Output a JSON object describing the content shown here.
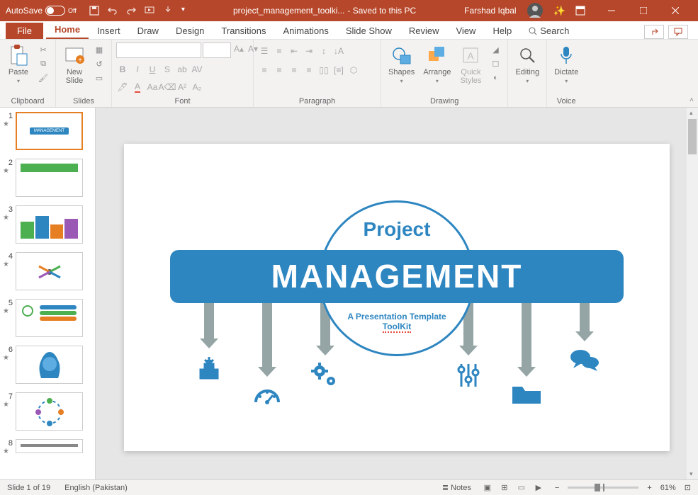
{
  "titlebar": {
    "autosave_label": "AutoSave",
    "autosave_state": "Off",
    "filename": "project_management_toolki...",
    "save_status": " - Saved to this PC",
    "user": "Farshad Iqbal"
  },
  "tabs": {
    "file": "File",
    "items": [
      "Home",
      "Insert",
      "Draw",
      "Design",
      "Transitions",
      "Animations",
      "Slide Show",
      "Review",
      "View",
      "Help"
    ],
    "search": "Search"
  },
  "ribbon": {
    "clipboard": {
      "label": "Clipboard",
      "paste": "Paste"
    },
    "slides": {
      "label": "Slides",
      "newslide": "New\nSlide"
    },
    "font": {
      "label": "Font"
    },
    "paragraph": {
      "label": "Paragraph"
    },
    "drawing": {
      "label": "Drawing",
      "shapes": "Shapes",
      "arrange": "Arrange",
      "quick": "Quick\nStyles"
    },
    "editing": {
      "label": "Editing"
    },
    "voice": {
      "label": "Voice",
      "dictate": "Dictate"
    }
  },
  "thumbnails": {
    "items": [
      1,
      2,
      3,
      4,
      5,
      6,
      7,
      8
    ],
    "selected": 1
  },
  "slide": {
    "title_small": "Project",
    "title_main": "MANAGEMENT",
    "subtitle": "A Presentation Template",
    "toolkit": "ToolKit"
  },
  "statusbar": {
    "slide_info": "Slide 1 of 19",
    "language": "English (Pakistan)",
    "notes": "Notes",
    "zoom": "61%"
  }
}
